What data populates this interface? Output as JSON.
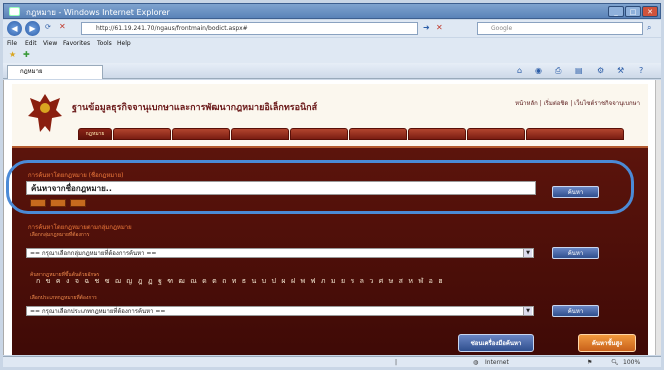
{
  "browser": {
    "title": "กฎหมาย - Windows Internet Explorer",
    "address": "http://61.19.241.70/ngaus/frontmain/bodict.aspx#",
    "search_placeholder": "Google",
    "menu": [
      "File",
      "Edit",
      "View",
      "Favorites",
      "Tools",
      "Help"
    ],
    "tab_label": "กฎหมาย",
    "status_zone": "Internet",
    "zoom": "100%"
  },
  "site": {
    "title": "ฐานข้อมูลธุรกิจจานุเบกษาและการพัฒนากฎหมายอิเล็กทรอนิกส์",
    "top_links": "หน้าหลัก | เริ่มต่อชิด | เว็บไซต์ราชกิจจานุเบกษา",
    "nav_tabs": [
      "กฎหมาย",
      "",
      "",
      "",
      "",
      "",
      "",
      "",
      ""
    ]
  },
  "search_keyword": {
    "section_title": "การค้นหาโดยกฎหมาย (ชื่อกฎหมาย)",
    "input_value": "ค้นหาจากชื่อกฎหมาย..",
    "mini_buttons": [
      "",
      "",
      ""
    ],
    "button": "ค้นหา"
  },
  "search_group": {
    "section_title": "การค้นหาโดยกฎหมายตามกลุ่มกฎหมาย",
    "sub_label": "เลือกกลุ่มกฎหมายที่ต้องการ",
    "select_value": "== กรุณาเลือกกลุ่มกฎหมายที่ต้องการค้นหา ==",
    "button": "ค้นหา"
  },
  "search_alpha": {
    "sub_label": "ค้นหากฎหมายที่ขึ้นต้นด้วยอักษร",
    "letters": "ก ข ค ง จ ฉ ช ซ ฌ ญ ฎ ฏ ฐ ฑ ฒ ณ ด ต ถ ท ธ น บ ป ผ ฝ พ ฟ ภ ม ย ร ล ว ศ ษ ส ห ฬ อ ฮ"
  },
  "search_type": {
    "sub_label": "เลือกประเภทกฎหมายที่ต้องการ",
    "select_value": "== กรุณาเลือกประเภทกฎหมายที่ต้องการค้นหา ==",
    "button": "ค้นหา"
  },
  "footer_buttons": {
    "advanced": "ซ่อนเครื่องมือค้นหา",
    "search_all": "ค้นหาขั้นสูง"
  },
  "colors": {
    "panel": "#5c140c",
    "accent": "#f07a3c",
    "highlight_ring": "#4b8ad6"
  }
}
